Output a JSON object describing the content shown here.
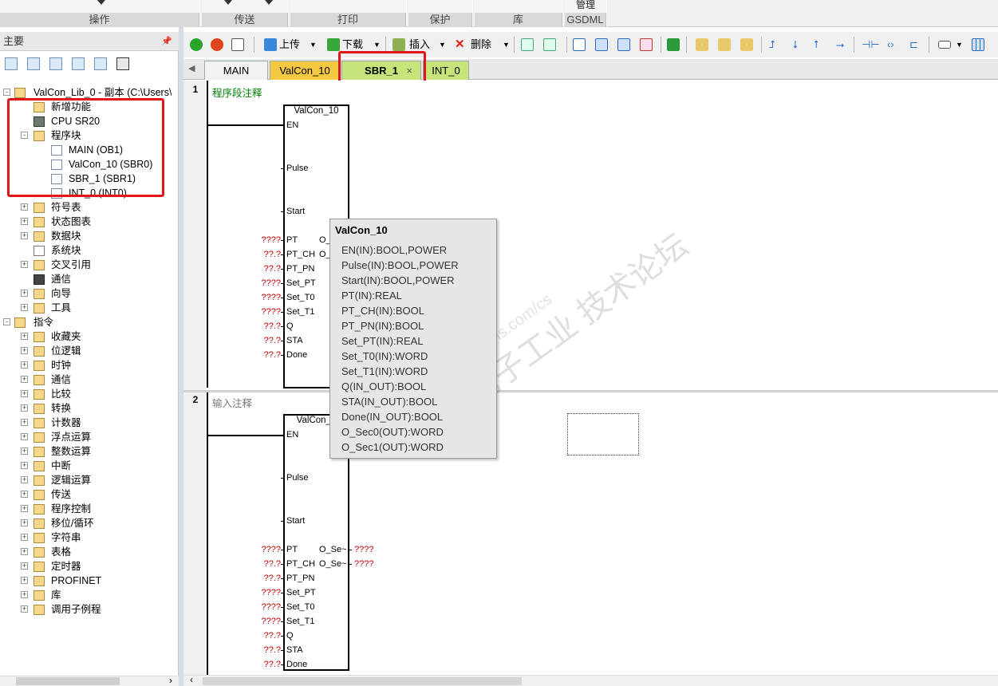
{
  "ribbon": {
    "groups": [
      "操作",
      "传送",
      "打印",
      "保护",
      "库",
      "GSDML"
    ],
    "gsdml_top": "管理"
  },
  "left_panel": {
    "title": "主要",
    "pin_icon": "pin-icon",
    "tree": [
      {
        "label": "ValCon_Lib_0 - 副本 (C:\\Users\\"
      },
      {
        "label": "新增功能"
      },
      {
        "label": "CPU SR20"
      },
      {
        "label": "程序块"
      },
      {
        "label": "MAIN (OB1)"
      },
      {
        "label": "ValCon_10 (SBR0)"
      },
      {
        "label": "SBR_1 (SBR1)"
      },
      {
        "label": "INT_0 (INT0)"
      },
      {
        "label": "符号表"
      },
      {
        "label": "状态图表"
      },
      {
        "label": "数据块"
      },
      {
        "label": "系统块"
      },
      {
        "label": "交叉引用"
      },
      {
        "label": "通信"
      },
      {
        "label": "向导"
      },
      {
        "label": "工具"
      },
      {
        "label": "指令"
      },
      {
        "label": "收藏夹"
      },
      {
        "label": "位逻辑"
      },
      {
        "label": "时钟"
      },
      {
        "label": "通信"
      },
      {
        "label": "比较"
      },
      {
        "label": "转换"
      },
      {
        "label": "计数器"
      },
      {
        "label": "浮点运算"
      },
      {
        "label": "整数运算"
      },
      {
        "label": "中断"
      },
      {
        "label": "逻辑运算"
      },
      {
        "label": "传送"
      },
      {
        "label": "程序控制"
      },
      {
        "label": "移位/循环"
      },
      {
        "label": "字符串"
      },
      {
        "label": "表格"
      },
      {
        "label": "定时器"
      },
      {
        "label": "PROFINET"
      },
      {
        "label": "库"
      },
      {
        "label": "调用子例程"
      }
    ]
  },
  "toolbar": {
    "upload": "上传",
    "download": "下载",
    "insert": "插入",
    "delete": "删除"
  },
  "tabs": {
    "main": "MAIN",
    "valcon": "ValCon_10",
    "sbr1": "SBR_1",
    "close": "×",
    "int0": "INT_0"
  },
  "editor": {
    "net1_num": "1",
    "net1_comment": "程序段注释",
    "net2_num": "2",
    "net2_comment": "输入注释",
    "block_title": "ValCon_10",
    "block2_title": "ValCon_1",
    "pins_in": [
      "EN",
      "Pulse",
      "Start",
      "PT",
      "PT_CH",
      "PT_PN",
      "Set_PT",
      "Set_T0",
      "Set_T1",
      "Q",
      "STA",
      "Done"
    ],
    "pins_out": [
      "O_",
      "O_"
    ],
    "pins_out2": [
      "O_Se~",
      "O_Se~"
    ],
    "labels_in": [
      "????",
      "??.?",
      "??.?",
      "????",
      "????",
      "????",
      "??.?",
      "??.?",
      "??.?"
    ],
    "labels_out2": [
      "????",
      "????"
    ]
  },
  "tooltip": {
    "title": "ValCon_10",
    "lines": [
      "EN(IN):BOOL,POWER",
      "Pulse(IN):BOOL,POWER",
      "Start(IN):BOOL,POWER",
      "PT(IN):REAL",
      "PT_CH(IN):BOOL",
      "PT_PN(IN):BOOL",
      "Set_PT(IN):REAL",
      "Set_T0(IN):WORD",
      "Set_T1(IN):WORD",
      "Q(IN_OUT):BOOL",
      "STA(IN_OUT):BOOL",
      "Done(IN_OUT):BOOL",
      "O_Sec0(OUT):WORD",
      "O_Sec1(OUT):WORD"
    ]
  },
  "watermark": {
    "line1": "西门子工业  技术论坛",
    "line2": "www.industry.siemens.com/cs"
  }
}
